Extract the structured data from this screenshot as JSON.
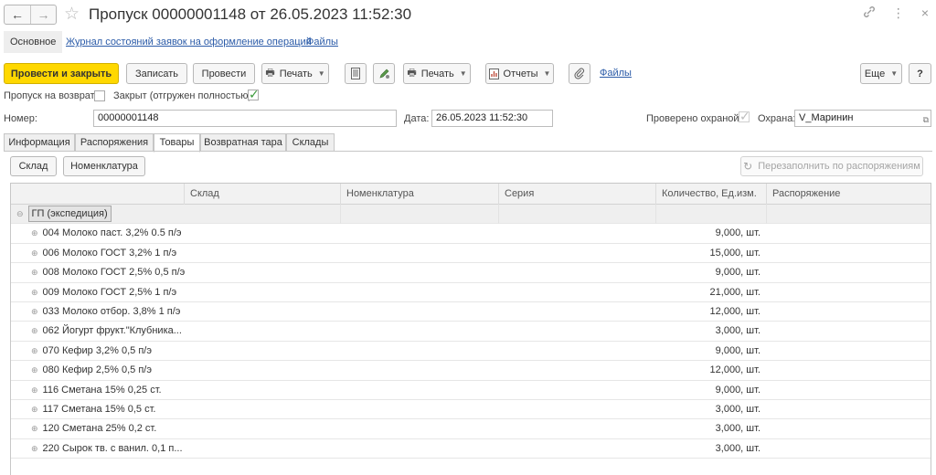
{
  "window": {
    "title": "Пропуск 00000001148 от 26.05.2023 11:52:30",
    "back_icon": "←",
    "forward_icon": "→",
    "star_icon": "☆",
    "link_icon": "⚲",
    "more_icon": "⋮",
    "close_icon": "×"
  },
  "sections": {
    "main": "Основное",
    "journal": "Журнал состояний заявок на оформление операций",
    "files": "Файлы"
  },
  "toolbar": {
    "post_close": "Провести и закрыть",
    "save": "Записать",
    "post": "Провести",
    "print1": "Печать",
    "print2": "Печать",
    "reports": "Отчеты",
    "files": "Файлы",
    "more": "Еще",
    "help": "?"
  },
  "flags": {
    "return_pass_label": "Пропуск на возврат:",
    "return_pass_checked": false,
    "closed_label": "Закрыт (отгружен полностью):",
    "closed_checked": true,
    "checked_guard_label": "Проверено охраной:",
    "checked_guard_checked": true
  },
  "fields": {
    "number_label": "Номер:",
    "number_value": "00000001148",
    "date_label": "Дата:",
    "date_value": "26.05.2023 11:52:30",
    "guard_label": "Охрана:",
    "guard_value": "V_Маринин"
  },
  "tabs": [
    "Информация",
    "Распоряжения",
    "Товары",
    "Возвратная тара",
    "Склады"
  ],
  "active_tab": "Товары",
  "table_toolbar": {
    "warehouse": "Склад",
    "nomenclature": "Номенклатура",
    "refill": "Перезаполнить по распоряжениям"
  },
  "grid": {
    "columns": [
      "",
      "Склад",
      "Номенклатура",
      "Серия",
      "Количество, Ед.изм.",
      "Распоряжение"
    ],
    "group": "ГП (экспедиция)",
    "rows": [
      {
        "name": "004 Молоко паст. 3,2% 0.5 п/э",
        "qty": "9,000, шт."
      },
      {
        "name": "006 Молоко ГОСТ 3,2% 1 п/э",
        "qty": "15,000, шт."
      },
      {
        "name": "008 Молоко ГОСТ 2,5% 0,5 п/э",
        "qty": "9,000, шт."
      },
      {
        "name": "009 Молоко ГОСТ 2,5% 1 п/э",
        "qty": "21,000, шт."
      },
      {
        "name": "033 Молоко отбор. 3,8% 1 п/э",
        "qty": "12,000, шт."
      },
      {
        "name": "062 Йогурт фрукт.\"Клубника...",
        "qty": "3,000, шт."
      },
      {
        "name": "070 Кефир 3,2% 0,5 п/э",
        "qty": "9,000, шт."
      },
      {
        "name": "080 Кефир 2,5% 0,5 п/э",
        "qty": "12,000, шт."
      },
      {
        "name": "116 Сметана 15% 0,25 ст.",
        "qty": "9,000, шт."
      },
      {
        "name": "117 Сметана 15% 0,5 ст.",
        "qty": "3,000, шт."
      },
      {
        "name": "120 Сметана 25% 0,2 ст.",
        "qty": "3,000, шт."
      },
      {
        "name": "220 Сырок тв. с ванил. 0,1 п...",
        "qty": "3,000, шт."
      }
    ]
  }
}
